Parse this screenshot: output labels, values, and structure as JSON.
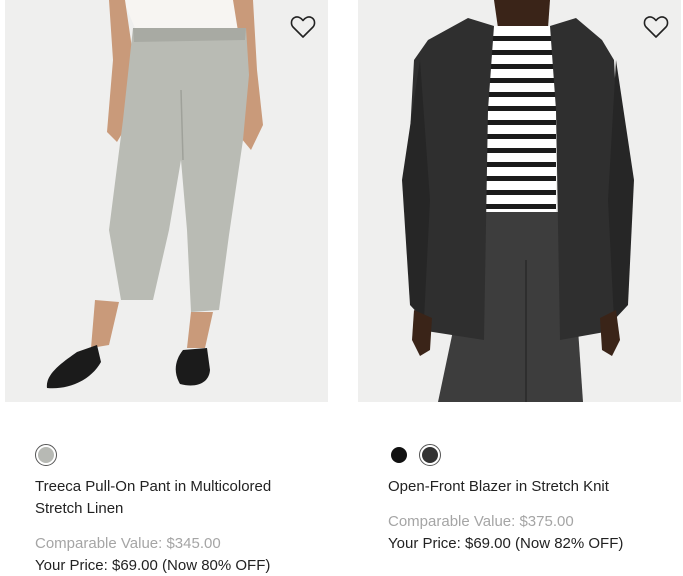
{
  "products": [
    {
      "name": "Treeca Pull-On Pant in Multicolored Stretch Linen",
      "comparable": "Comparable Value: $345.00",
      "price": "Your Price: $69.00 (Now 80% OFF)",
      "swatch_colors": [
        "#b7b9b4"
      ],
      "wishlist_icon": "heart-outline-icon"
    },
    {
      "name": "Open-Front Blazer in Stretch Knit",
      "comparable": "Comparable Value: $375.00",
      "price": "Your Price: $69.00 (Now 82% OFF)",
      "swatch_colors": [
        "#111111",
        "#333333"
      ],
      "wishlist_icon": "heart-outline-icon"
    }
  ]
}
